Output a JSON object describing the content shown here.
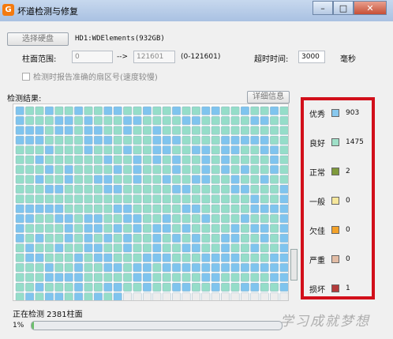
{
  "window": {
    "title": "坏道检测与修复",
    "app_icon_glyph": "G",
    "minimize_glyph": "–",
    "maximize_glyph": "□",
    "close_glyph": "✕"
  },
  "toolbar": {
    "select_disk_label": "选择硬盘",
    "disk_name": "HD1:WDElements(932GB)"
  },
  "range": {
    "label": "柱面范围:",
    "from_value": "0",
    "arrow": "-->",
    "to_value": "121601",
    "hint": "(0-121601)",
    "timeout_label": "超时时间:",
    "timeout_value": "3000",
    "timeout_unit": "毫秒"
  },
  "option": {
    "checkbox_label": "检测时报告准确的扇区号(速度较慢)",
    "checked": false
  },
  "results": {
    "label": "检测结果:",
    "detail_button": "详细信息",
    "grid": {
      "columns": 28,
      "rows": 20,
      "filled_cells": 543,
      "colors": {
        "good": "#95ddc9",
        "excellent": "#7fc4ee",
        "pending": "#ededed"
      }
    }
  },
  "legend": [
    {
      "label": "优秀",
      "color": "#88c8ee",
      "count": "903"
    },
    {
      "label": "良好",
      "color": "#9fe0c8",
      "count": "1475"
    },
    {
      "label": "正常",
      "color": "#7f9a3c",
      "count": "2"
    },
    {
      "label": "一般",
      "color": "#f6e79c",
      "count": "0"
    },
    {
      "label": "欠佳",
      "color": "#f3a22a",
      "count": "0"
    },
    {
      "label": "严重",
      "color": "#e2bca5",
      "count": "0"
    },
    {
      "label": "损坏",
      "color": "#b43b3b",
      "count": "1"
    }
  ],
  "status": {
    "text": "正在检测  2381柱面",
    "percent_text": "1%",
    "progress": 0.01
  },
  "watermark": "学习成就梦想"
}
